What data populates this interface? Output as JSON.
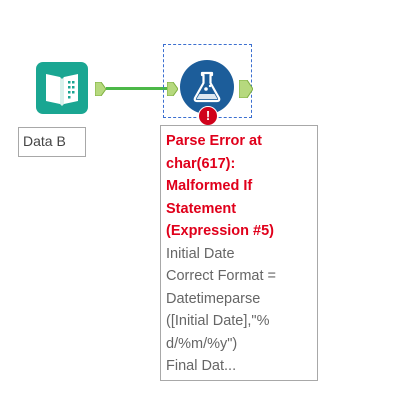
{
  "canvas": {
    "input_tool": {
      "label": "Data B",
      "icon": "book-input-icon",
      "color": "#1aa692"
    },
    "formula_tool": {
      "icon": "flask-icon",
      "color": "#1c5d9a"
    },
    "error_badge": {
      "glyph": "!",
      "color": "#d0021b"
    },
    "connector_color": "#4cb848",
    "annotation": {
      "error_lines": [
        "Parse Error at",
        "char(617):",
        "Malformed If",
        "Statement",
        "(Expression #5)"
      ],
      "expression_lines": [
        "Initial Date",
        "Correct Format =",
        "Datetimeparse",
        "([Initial Date],\"%",
        "d/%m/%y\")",
        "Final Dat..."
      ],
      "error_color": "#e0001b"
    }
  }
}
